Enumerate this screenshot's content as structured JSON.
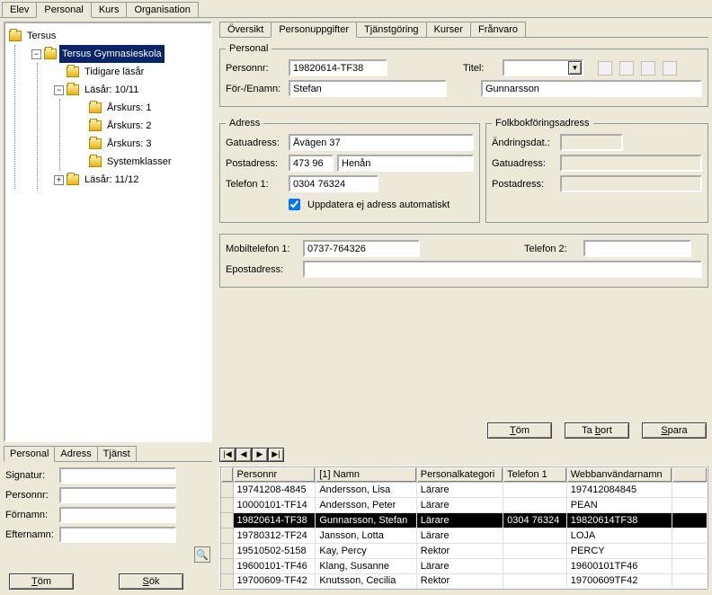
{
  "main_tabs": {
    "t0": "Elev",
    "t1": "Personal",
    "t2": "Kurs",
    "t3": "Organisation"
  },
  "tree": {
    "root": "Tersus",
    "school": "Tersus Gymnasieskola",
    "n_tidigare": "Tidigare läsår",
    "n_1011": "Läsår: 10/11",
    "n_ak1": "Årskurs: 1",
    "n_ak2": "Årskurs: 2",
    "n_ak3": "Årskurs: 3",
    "n_sys": "Systemklasser",
    "n_1112": "Läsår: 11/12"
  },
  "left_sub_tabs": {
    "t0": "Personal",
    "t1": "Adress",
    "t2": "Tjänst"
  },
  "search": {
    "l_sig": "Signatur:",
    "l_pnr": "Personnr:",
    "l_fn": "Förnamn:",
    "l_en": "Efternamn:",
    "v_sig": "",
    "v_pnr": "",
    "v_fn": "",
    "v_en": ""
  },
  "left_btns": {
    "tom": "Töm",
    "sok": "Sök"
  },
  "detail_tabs": {
    "t0": "Översikt",
    "t1": "Personuppgifter",
    "t2": "Tjänstgöring",
    "t3": "Kurser",
    "t4": "Frånvaro"
  },
  "personal": {
    "legend": "Personal",
    "l_personnr": "Personnr:",
    "v_personnr": "19820614-TF38",
    "l_titel": "Titel:",
    "v_titel": "",
    "l_forenamn": "För-/Enamn:",
    "v_for": "Stefan",
    "v_en": "Gunnarsson"
  },
  "adress": {
    "legend": "Adress",
    "l_gatu": "Gatuadress:",
    "v_gatu": "Åvägen 37",
    "l_post": "Postadress:",
    "v_post1": "473 96",
    "v_post2": "Henån",
    "l_tel1": "Telefon 1:",
    "v_tel1": "0304 76324",
    "chk_label": "Uppdatera ej adress automatiskt"
  },
  "fbk": {
    "legend": "Folkbokföringsadress",
    "l_andr": "Ändringsdat.:",
    "v_andr": "",
    "l_gatu": "Gatuadress:",
    "v_gatu": "",
    "l_post": "Postadress:",
    "v_post": ""
  },
  "contact": {
    "l_mob": "Mobiltelefon 1:",
    "v_mob": "0737-764326",
    "l_tel2": "Telefon 2:",
    "v_tel2": "",
    "l_ep": "Epostadress:",
    "v_ep": ""
  },
  "actions": {
    "tom": "Töm",
    "tabort": "Ta bort",
    "spara": "Spara"
  },
  "grid": {
    "h0": "Personnr",
    "h1": "[1] Namn",
    "h2": "Personalkategori",
    "h3": "Telefon 1",
    "h4": "Webbanvändarnamn",
    "rows": [
      {
        "c0": "19741208-4845",
        "c1": "Andersson, Lisa",
        "c2": "Lärare",
        "c3": "",
        "c4": "197412084845"
      },
      {
        "c0": "10000101-TF14",
        "c1": "Andersson, Peter",
        "c2": "Lärare",
        "c3": "",
        "c4": "PEAN"
      },
      {
        "c0": "19820614-TF38",
        "c1": "Gunnarsson, Stefan",
        "c2": "Lärare",
        "c3": "0304 76324",
        "c4": "19820614TF38"
      },
      {
        "c0": "19780312-TF24",
        "c1": "Jansson, Lotta",
        "c2": "Lärare",
        "c3": "",
        "c4": "LOJA"
      },
      {
        "c0": "19510502-5158",
        "c1": "Kay, Percy",
        "c2": "Rektor",
        "c3": "",
        "c4": "PERCY"
      },
      {
        "c0": "19600101-TF46",
        "c1": "Klang, Susanne",
        "c2": "Lärare",
        "c3": "",
        "c4": "19600101TF46"
      },
      {
        "c0": "19700609-TF42",
        "c1": "Knutsson, Cecilia",
        "c2": "Rektor",
        "c3": "",
        "c4": "19700609TF42"
      }
    ]
  }
}
